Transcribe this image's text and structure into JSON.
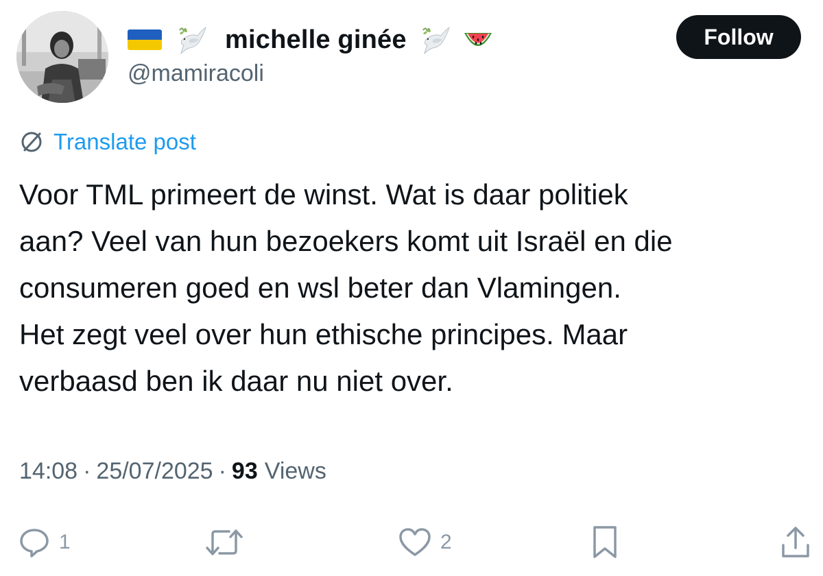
{
  "author": {
    "display_name": "michelle ginée",
    "handle": "@mamiracoli",
    "flag_icon": "ukraine-flag-icon",
    "emoji_icons": [
      "dove-icon",
      "dove-icon",
      "watermelon-icon"
    ]
  },
  "follow_button": {
    "label": "Follow"
  },
  "translate": {
    "label": "Translate post",
    "icon": "globe-icon"
  },
  "post": {
    "text": "Voor TML primeert de winst. Wat is daar politiek\naan? Veel van hun bezoekers komt uit Israël en die\nconsumeren goed en wsl beter dan Vlamingen.\nHet zegt veel over hun ethische principes. Maar\nverbaasd ben ik daar nu niet over."
  },
  "meta": {
    "time": "14:08",
    "separator": "·",
    "date": "25/07/2025",
    "views_count": "93",
    "views_label": "Views"
  },
  "actions": {
    "reply_count": "1",
    "repost_count": "",
    "like_count": "2"
  },
  "colors": {
    "text": "#0f1419",
    "secondary": "#536471",
    "accent": "#1d9bf0",
    "button_bg": "#0f1419"
  }
}
